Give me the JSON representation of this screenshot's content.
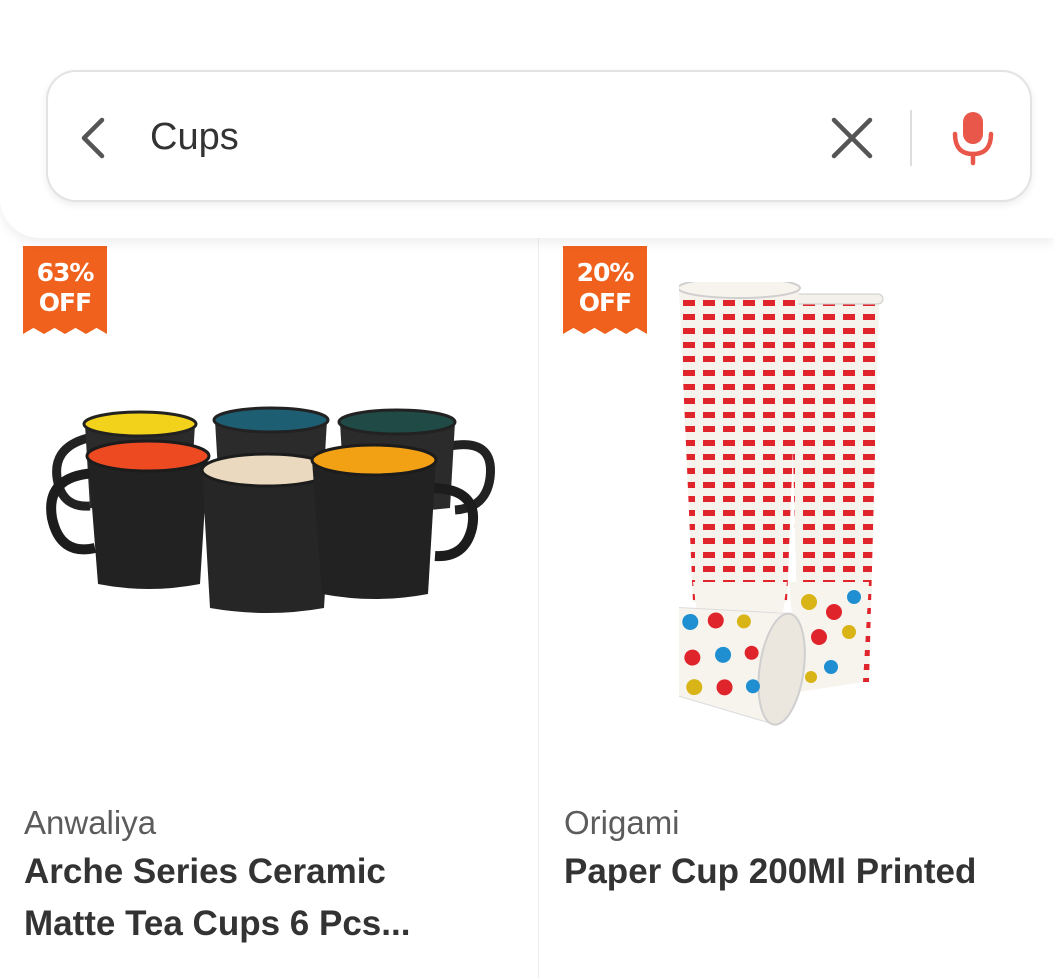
{
  "search": {
    "value": "Cups",
    "back_icon": "chevron-left-icon",
    "clear_icon": "close-icon",
    "mic_icon": "microphone-icon",
    "mic_color": "#e8574a"
  },
  "products": [
    {
      "discount_line1": "63%",
      "discount_line2": "OFF",
      "brand": "Anwaliya",
      "title_line1": "Arche Series Ceramic",
      "title_line2": "Matte Tea Cups 6 Pcs..."
    },
    {
      "discount_line1": "20%",
      "discount_line2": "OFF",
      "brand": "Origami",
      "title_line1": "Paper Cup 200Ml Printed",
      "title_line2": ""
    }
  ],
  "colors": {
    "badge": "#f0611d",
    "text_primary": "#333333",
    "text_secondary": "#5c5c5c"
  }
}
